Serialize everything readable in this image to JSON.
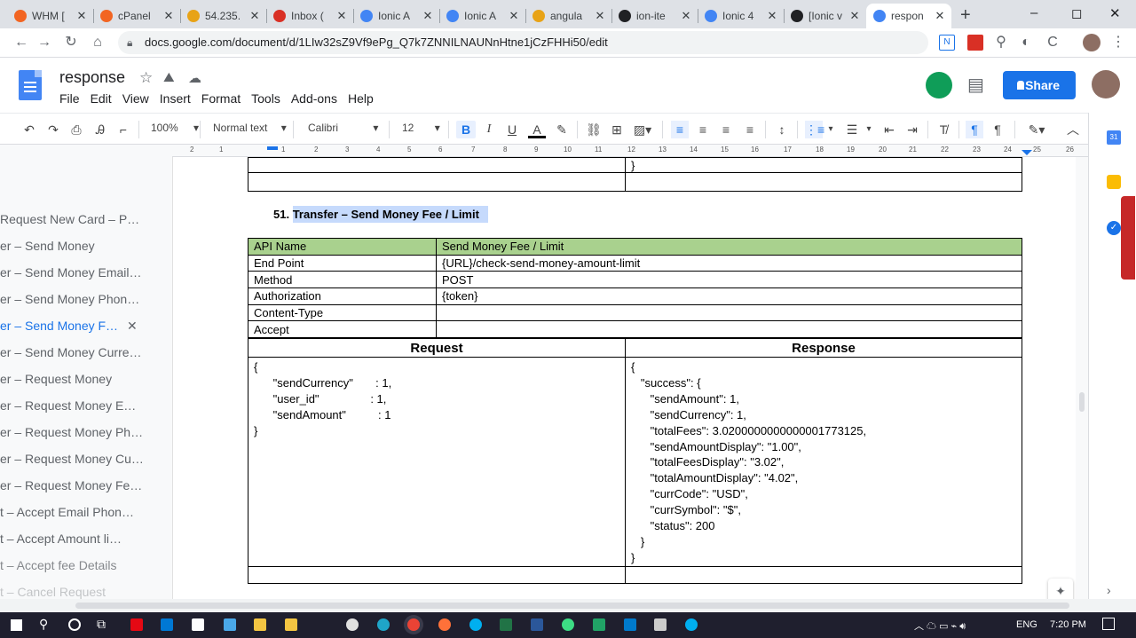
{
  "browser": {
    "tabs": [
      {
        "label": "WHM [",
        "color": "#f26522"
      },
      {
        "label": "cPanel",
        "color": "#f26522"
      },
      {
        "label": "54.235.",
        "color": "#e8a317"
      },
      {
        "label": "Inbox (",
        "color": "#d93025"
      },
      {
        "label": "Ionic A",
        "color": "#4285f4"
      },
      {
        "label": "Ionic A",
        "color": "#4285f4"
      },
      {
        "label": "angula",
        "color": "#e8a317"
      },
      {
        "label": "ion-ite",
        "color": "#202124"
      },
      {
        "label": "Ionic 4",
        "color": "#4285f4"
      },
      {
        "label": "[Ionic v",
        "color": "#202124"
      },
      {
        "label": "respon",
        "color": "#4285f4"
      }
    ],
    "new_tab": "+",
    "url": "docs.google.com/document/d/1LIw32sZ9Vf9ePg_Q7k7ZNNILNAUNnHtne1jCzFHHi50/edit",
    "window_controls": [
      "–",
      "◻",
      "✕"
    ]
  },
  "doc": {
    "title": "response",
    "menu": [
      "File",
      "Edit",
      "View",
      "Insert",
      "Format",
      "Tools",
      "Add-ons",
      "Help"
    ],
    "share_label": "Share"
  },
  "toolbar": {
    "zoom": "100%",
    "style": "Normal text",
    "font": "Calibri",
    "size": "12",
    "bold": "B",
    "italic": "I",
    "underline": "U",
    "textcolor": "A"
  },
  "ruler": [
    "2",
    "1",
    "1",
    "2",
    "3",
    "4",
    "5",
    "6",
    "7",
    "8",
    "9",
    "10",
    "11",
    "12",
    "13",
    "14",
    "15",
    "16",
    "17",
    "18",
    "19",
    "20",
    "21",
    "22",
    "23",
    "24",
    "25",
    "26"
  ],
  "outline": [
    {
      "label": "Request New Card – P…",
      "selected": false
    },
    {
      "label": "er – Send Money",
      "selected": false
    },
    {
      "label": "er – Send Money Email…",
      "selected": false
    },
    {
      "label": "er – Send Money Phon…",
      "selected": false
    },
    {
      "label": "er – Send Money F…",
      "selected": true
    },
    {
      "label": "er – Send Money Curre…",
      "selected": false
    },
    {
      "label": "er – Request Money",
      "selected": false
    },
    {
      "label": "er – Request Money E…",
      "selected": false
    },
    {
      "label": "er – Request Money Ph…",
      "selected": false
    },
    {
      "label": "er – Request Money Cu…",
      "selected": false
    },
    {
      "label": "er – Request Money Fe…",
      "selected": false
    },
    {
      "label": "t – Accept Email Phon…",
      "selected": false
    },
    {
      "label": "t – Accept Amount li…",
      "selected": false
    },
    {
      "label": "t – Accept fee Details",
      "selected": false
    },
    {
      "label": "t – Cancel Request",
      "selected": false
    }
  ],
  "outline_close": "✕",
  "section": {
    "number": "51.",
    "heading": "Transfer – Send Money Fee / Limit"
  },
  "api": {
    "rows": [
      {
        "key": "API Name",
        "value": "Send Money Fee / Limit"
      },
      {
        "key": "End Point",
        "value": "{URL}/check-send-money-amount-limit"
      },
      {
        "key": "Method",
        "value": "POST"
      },
      {
        "key": "Authorization",
        "value": "{token}"
      },
      {
        "key": "Content-Type",
        "value": ""
      },
      {
        "key": "Accept",
        "value": ""
      }
    ],
    "request_header": "Request",
    "response_header": "Response",
    "request_lines": [
      "{",
      "      \"sendCurrency\"       : 1,",
      "      \"user_id\"                : 1,",
      "      \"sendAmount\"          : 1",
      "}"
    ],
    "response_lines": [
      "{",
      "   \"success\": {",
      "      \"sendAmount\": 1,",
      "      \"sendCurrency\": 1,",
      "      \"totalFees\": 3.0200000000000001773125,",
      "      \"sendAmountDisplay\": \"1.00\",",
      "      \"totalFeesDisplay\": \"3.02\",",
      "      \"totalAmountDisplay\": \"4.02\",",
      "      \"currCode\": \"USD\",",
      "      \"currSymbol\": \"$\",",
      "      \"status\": 200",
      "   }",
      "}"
    ],
    "prev_table_tail": "}"
  },
  "taskbar": {
    "lang": "ENG",
    "time": "7:20 PM"
  },
  "colors": {
    "header_row_bg": "#a9d18e",
    "heading_highlight": "#c6dafc",
    "share_bg": "#1a73e8",
    "accent": "#1a73e8"
  }
}
